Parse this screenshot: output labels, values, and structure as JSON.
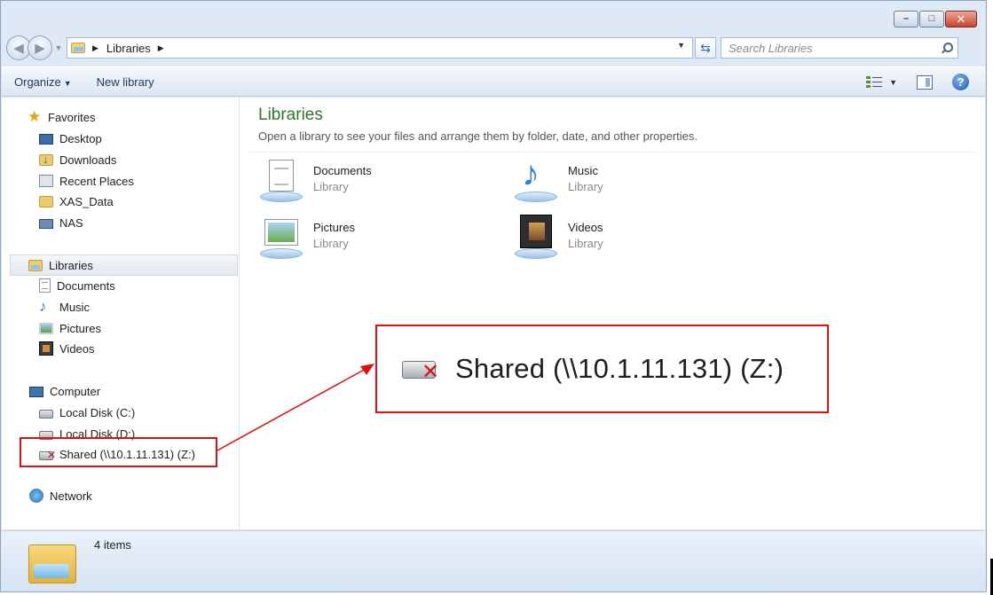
{
  "titlebar": {
    "minimize": "–",
    "maximize": "□",
    "close": "✕"
  },
  "navbar": {
    "breadcrumb": "Libraries",
    "search_placeholder": "Search Libraries"
  },
  "commandbar": {
    "organize": "Organize",
    "new_library": "New library"
  },
  "sidebar": {
    "favorites": {
      "header": "Favorites",
      "items": [
        "Desktop",
        "Downloads",
        "Recent Places",
        "XAS_Data",
        "NAS"
      ]
    },
    "libraries": {
      "header": "Libraries",
      "items": [
        "Documents",
        "Music",
        "Pictures",
        "Videos"
      ]
    },
    "computer": {
      "header": "Computer",
      "items": [
        "Local Disk (C:)",
        "Local Disk (D:)",
        "Shared (\\\\10.1.11.131) (Z:)"
      ]
    },
    "network": {
      "header": "Network"
    }
  },
  "main": {
    "title": "Libraries",
    "subtitle": "Open a library to see your files and arrange them by folder, date, and other properties.",
    "libraries": [
      {
        "name": "Documents",
        "kind": "Library"
      },
      {
        "name": "Music",
        "kind": "Library"
      },
      {
        "name": "Pictures",
        "kind": "Library"
      },
      {
        "name": "Videos",
        "kind": "Library"
      }
    ]
  },
  "callout": {
    "text": "Shared (\\\\10.1.11.131) (Z:)",
    "color": "#e01010"
  },
  "statusbar": {
    "count": "4 items"
  }
}
